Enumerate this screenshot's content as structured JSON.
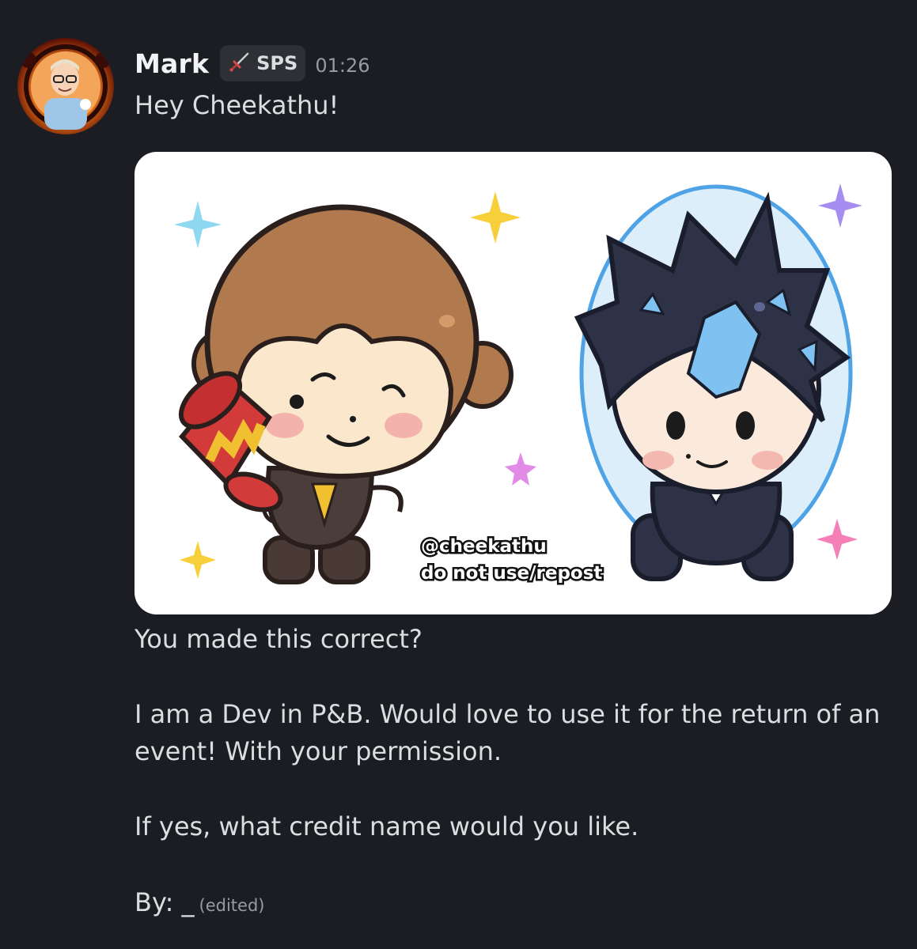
{
  "message": {
    "author": "Mark",
    "role_tag": {
      "label": "SPS",
      "icon": "sword-icon",
      "color": "#e06666"
    },
    "time": "01:26",
    "greeting": "Hey Cheekathu!",
    "attachment": {
      "watermark_line1": "@cheekathu",
      "watermark_line2": "do not use/repost"
    },
    "body": [
      "You made this correct?",
      "I am a Dev in P&B. Would love to use it for the return of an",
      "event! With your permission.",
      "If yes, what credit name would you like.",
      "By: _"
    ],
    "edited_label": "(edited)"
  },
  "colors": {
    "background": "#1c1d22",
    "username": "#f2f3f5",
    "text": "#dbdee1",
    "muted": "#949ba4",
    "tag_bg": "#2e3035"
  }
}
